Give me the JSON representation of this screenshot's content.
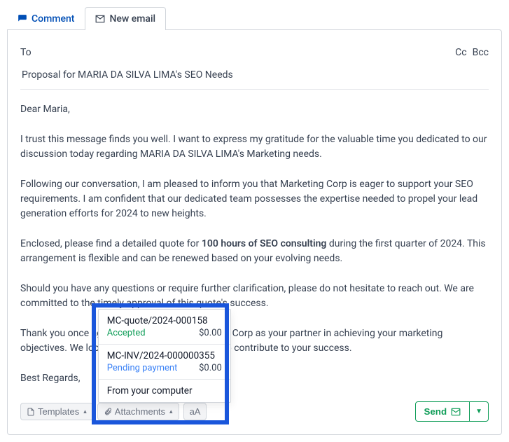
{
  "tabs": {
    "comment": "Comment",
    "newEmail": "New email"
  },
  "to": {
    "label": "To",
    "cc": "Cc",
    "bcc": "Bcc"
  },
  "subject": "Proposal for MARIA DA SILVA LIMA's SEO Needs",
  "body": {
    "p1": "Dear Maria,",
    "p2": "I trust this message finds you well. I want to express my gratitude for the valuable time you dedicated to our discussion today regarding MARIA DA SILVA LIMA's Marketing needs.",
    "p3": "Following our conversation, I am pleased to inform you that Marketing Corp is eager to support your SEO requirements. I am confident that our dedicated team possesses the expertise needed to propel your lead generation efforts for 2024 to new heights.",
    "p4a": "Enclosed, please find a detailed quote for ",
    "p4b": "100 hours of SEO consulting",
    "p4c": " during the first quarter of 2024. This arrangement is flexible and can be renewed based on your evolving needs.",
    "p5": "Should you have any questions or require further clarification, please do not hesitate to reach out. We are committed to the timely approval of this quote's success.",
    "p6": "Thank you once again for considering Marketing Corp as your partner in achieving your marketing objectives. We look forward to the opportunity to contribute to your success.",
    "p7": "Best Regards,"
  },
  "toolbar": {
    "templates": "Templates",
    "attachments": "Attachments",
    "textcase": "aA",
    "send": "Send"
  },
  "dropdown": {
    "items": [
      {
        "title": "MC-quote/2024-000158",
        "status": "Accepted",
        "statusClass": "accepted",
        "price": "$0.00"
      },
      {
        "title": "MC-INV/2024-000000355",
        "status": "Pending payment",
        "statusClass": "pending",
        "price": "$0.00"
      }
    ],
    "fromComputer": "From your computer"
  }
}
